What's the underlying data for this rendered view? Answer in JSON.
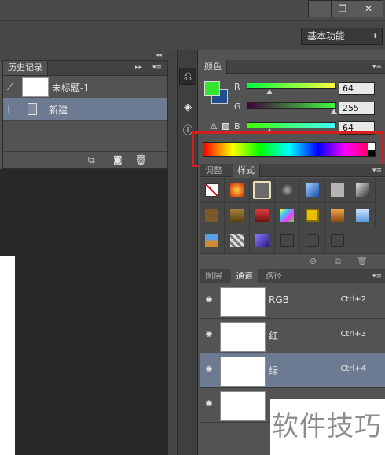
{
  "window": {
    "minimize_glyph": "—",
    "restore_glyph": "❐",
    "close_glyph": "✕"
  },
  "options_bar": {
    "workspace": "基本功能",
    "workspace_arrow": "⬍"
  },
  "collapse_arrows": {
    "left": "◂◂",
    "right": "▸▸",
    "strip": "◂◂"
  },
  "history_panel": {
    "tab": "历史记录",
    "collapse": "▸▸",
    "items": [
      {
        "label": "未标题-1",
        "icon": "history-brush-icon"
      },
      {
        "label": "新建",
        "icon": "document-icon",
        "selected": true
      }
    ],
    "bottom_icons": [
      "new-document-from-state-icon",
      "snapshot-camera-icon",
      "trash-icon"
    ]
  },
  "color_panel": {
    "tab": "颜色",
    "foreground": "#33e633",
    "background": "#1c4f8c",
    "channels": [
      {
        "label": "R",
        "value": "64"
      },
      {
        "label": "G",
        "value": "255"
      },
      {
        "label": "B",
        "value": "64"
      }
    ],
    "warning_glyph": "⚠"
  },
  "styles_panel": {
    "tabs": [
      "调整",
      "样式"
    ],
    "active_tab": "样式"
  },
  "channels_panel": {
    "tabs": [
      "图层",
      "通道",
      "路径"
    ],
    "active_tab": "通道",
    "rows": [
      {
        "name": "RGB",
        "shortcut": "Ctrl+2"
      },
      {
        "name": "红",
        "shortcut": "Ctrl+3"
      },
      {
        "name": "绿",
        "shortcut": "Ctrl+4",
        "selected": true
      },
      {
        "name": "",
        "shortcut": ""
      }
    ]
  },
  "watermark": "软件技巧",
  "colors": {
    "highlight_box": "#d21f1f",
    "selection": "#6c7a92"
  }
}
